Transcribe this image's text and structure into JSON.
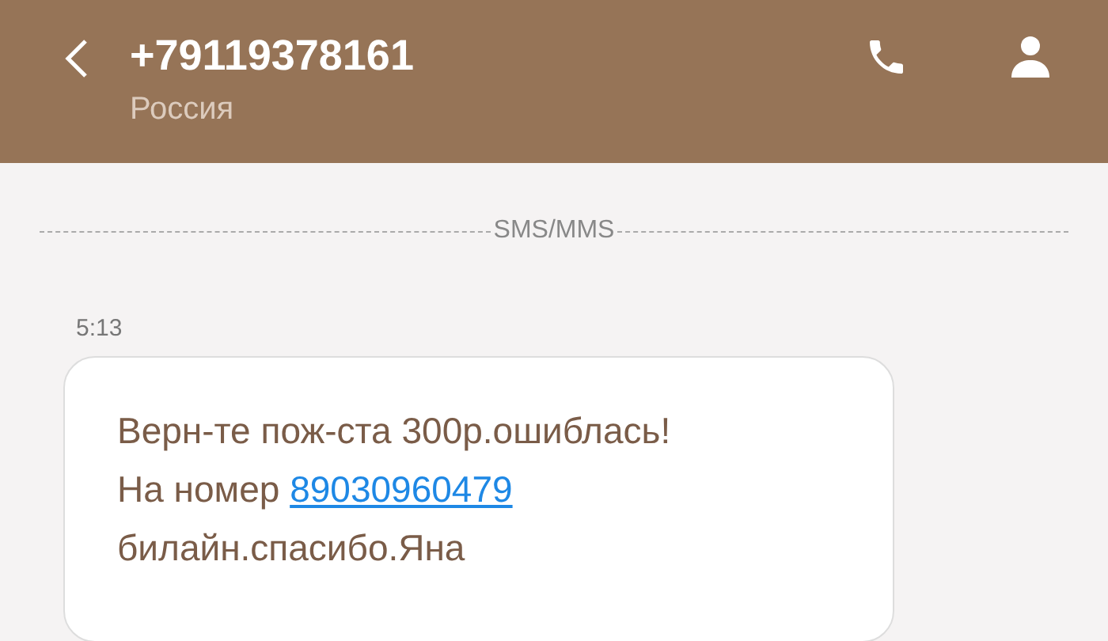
{
  "header": {
    "title": "+79119378161",
    "subtitle": "Россия"
  },
  "divider_label": "SMS/MMS",
  "messages": [
    {
      "time": "5:13",
      "text_before": "Верн-те пож-ста 300р.ошиблась!\nНа номер ",
      "link": "89030960479",
      "text_after": "\nбилайн.спасибо.Яна"
    }
  ]
}
